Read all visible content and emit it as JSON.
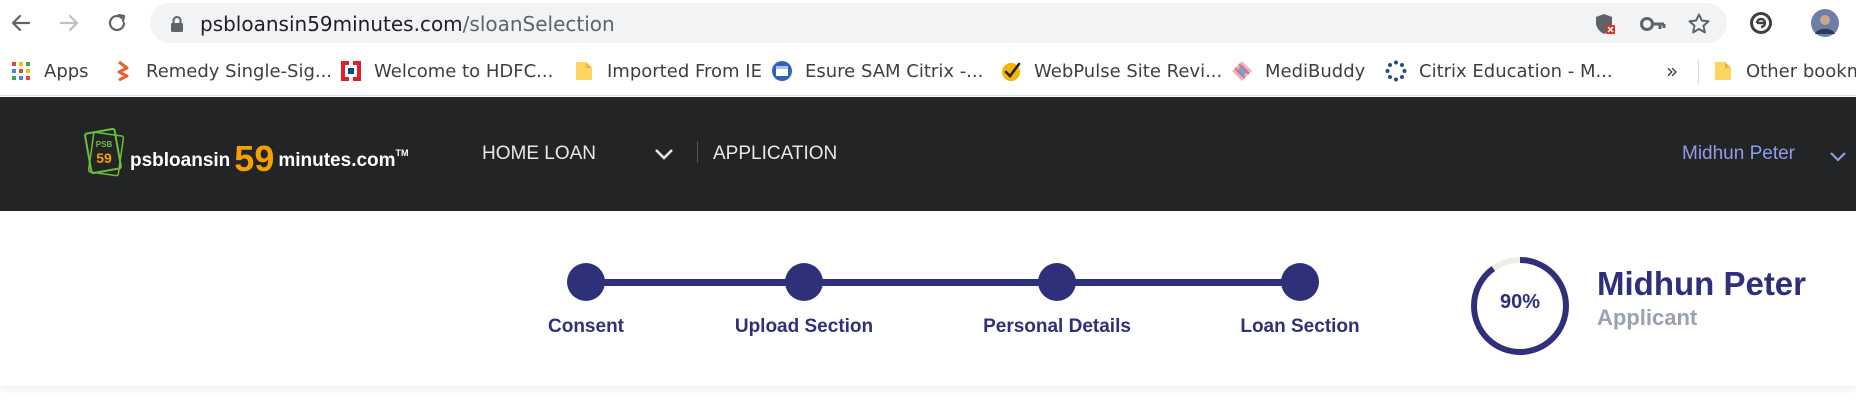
{
  "browser": {
    "url_domain": "psbloansin59minutes.com",
    "url_path": "/sloanSelection",
    "icons": [
      "back-arrow-icon",
      "forward-arrow-icon",
      "reload-icon",
      "lock-icon",
      "shield-blocked-icon",
      "key-icon",
      "star-icon",
      "extension-icon",
      "profile-avatar-icon"
    ]
  },
  "bookmarks": {
    "items": [
      {
        "label": "Apps",
        "icon": "apps-grid-icon"
      },
      {
        "label": "Remedy Single-Sig...",
        "icon": "remedy-icon"
      },
      {
        "label": "Welcome to HDFC...",
        "icon": "hdfc-icon"
      },
      {
        "label": "Imported From IE",
        "icon": "folder-icon"
      },
      {
        "label": "Esure SAM Citrix -...",
        "icon": "citrix-window-icon"
      },
      {
        "label": "WebPulse Site Revi...",
        "icon": "webpulse-icon"
      },
      {
        "label": "MediBuddy",
        "icon": "medibuddy-icon"
      },
      {
        "label": "Citrix Education - M...",
        "icon": "citrix-dots-icon"
      }
    ],
    "overflow": "»",
    "other": "Other bookma"
  },
  "header": {
    "logo_part1": "psbloansin",
    "logo_59": "59",
    "logo_part2": "minutes.com",
    "logo_tm": "TM",
    "logo_badge_top": "PSB",
    "logo_badge_num": "59",
    "nav_home_loan": "HOME LOAN",
    "nav_application": "APPLICATION",
    "user_name": "Midhun Peter"
  },
  "stepper": {
    "steps": [
      {
        "label": "Consent"
      },
      {
        "label": "Upload Section"
      },
      {
        "label": "Personal Details"
      },
      {
        "label": "Loan Section"
      }
    ]
  },
  "profile": {
    "progress_text": "90%",
    "progress_value": 0.9,
    "name": "Midhun Peter",
    "role": "Applicant"
  },
  "colors": {
    "accent": "#2e3079",
    "header_bg": "#232425",
    "logo_orange": "#f5a100",
    "user_link": "#8f9ce8"
  }
}
